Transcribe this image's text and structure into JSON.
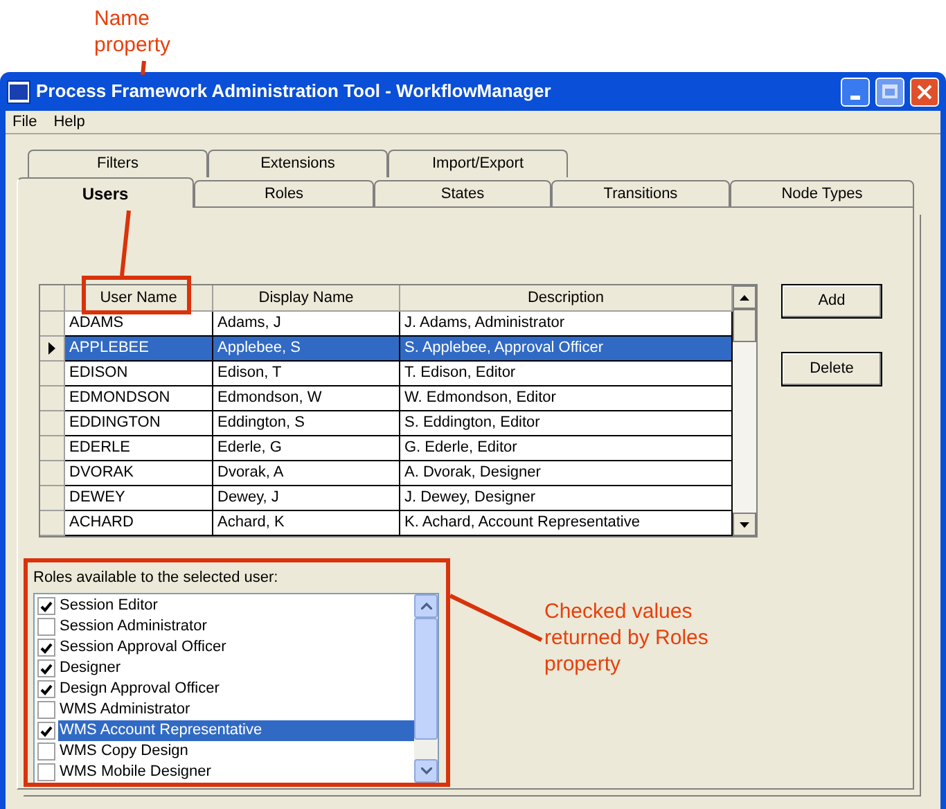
{
  "callouts": [
    {
      "text": "Name property"
    },
    {
      "text": "Checked values returned by Roles property"
    }
  ],
  "window": {
    "title": "Process Framework Administration Tool - WorkflowManager"
  },
  "menu": [
    "File",
    "Help"
  ],
  "tabs_back": [
    {
      "label": "Filters",
      "selected": false
    },
    {
      "label": "Extensions",
      "selected": false
    },
    {
      "label": "Import/Export",
      "selected": false
    }
  ],
  "tabs_front": [
    {
      "label": "Users",
      "selected": true
    },
    {
      "label": "Roles",
      "selected": false
    },
    {
      "label": "States",
      "selected": false
    },
    {
      "label": "Transitions",
      "selected": false
    },
    {
      "label": "Node Types",
      "selected": false
    }
  ],
  "users_grid": {
    "columns": [
      "User Name",
      "Display Name",
      "Description"
    ],
    "rows": [
      {
        "cells": [
          "ADAMS",
          "Adams, J",
          "J. Adams, Administrator"
        ],
        "selected": false
      },
      {
        "cells": [
          "APPLEBEE",
          "Applebee, S",
          "S. Applebee, Approval Officer"
        ],
        "selected": true
      },
      {
        "cells": [
          "EDISON",
          "Edison, T",
          "T. Edison, Editor"
        ],
        "selected": false
      },
      {
        "cells": [
          "EDMONDSON",
          "Edmondson, W",
          "W. Edmondson, Editor"
        ],
        "selected": false
      },
      {
        "cells": [
          "EDDINGTON",
          "Eddington, S",
          "S. Eddington, Editor"
        ],
        "selected": false
      },
      {
        "cells": [
          "EDERLE",
          "Ederle, G",
          "G. Ederle, Editor"
        ],
        "selected": false
      },
      {
        "cells": [
          "DVORAK",
          "Dvorak, A",
          "A. Dvorak, Designer"
        ],
        "selected": false
      },
      {
        "cells": [
          "DEWEY",
          "Dewey, J",
          "J. Dewey, Designer"
        ],
        "selected": false
      },
      {
        "cells": [
          "ACHARD",
          "Achard, K",
          "K. Achard, Account Representative"
        ],
        "selected": false
      }
    ]
  },
  "buttons": [
    "Add",
    "Delete"
  ],
  "roles": {
    "label": "Roles available to the selected user:",
    "items": [
      {
        "label": "Session Editor",
        "checked": true,
        "selected": false
      },
      {
        "label": "Session Administrator",
        "checked": false,
        "selected": false
      },
      {
        "label": "Session Approval Officer",
        "checked": true,
        "selected": false
      },
      {
        "label": "Designer",
        "checked": true,
        "selected": false
      },
      {
        "label": "Design Approval Officer",
        "checked": true,
        "selected": false
      },
      {
        "label": "WMS Administrator",
        "checked": false,
        "selected": false
      },
      {
        "label": "WMS Account Representative",
        "checked": true,
        "selected": true
      },
      {
        "label": "WMS Copy Design",
        "checked": false,
        "selected": false
      },
      {
        "label": "WMS Mobile Designer",
        "checked": false,
        "selected": false
      }
    ]
  }
}
